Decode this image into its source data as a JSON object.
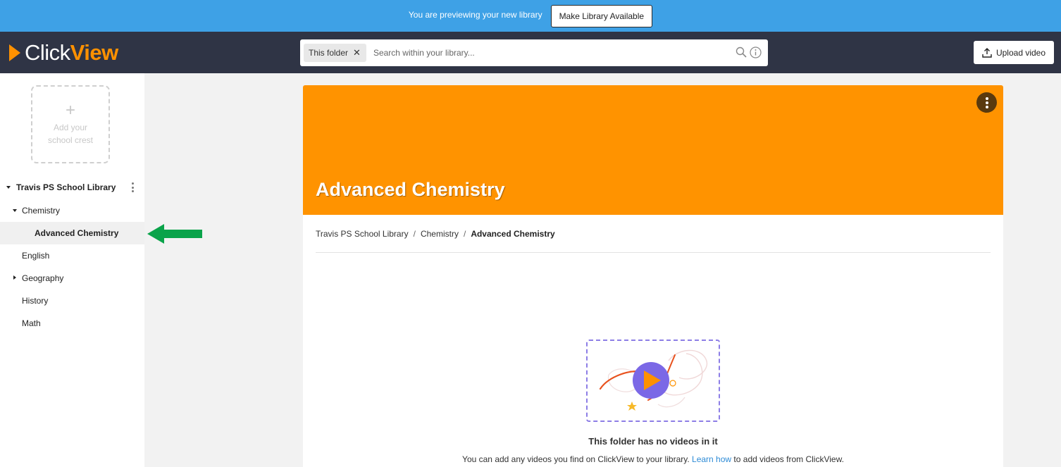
{
  "preview_bar": {
    "message": "You are previewing your new library",
    "make_available_label": "Make Library Available"
  },
  "header": {
    "logo_click": "Click",
    "logo_view": "View",
    "search": {
      "chip_label": "This folder",
      "placeholder": "Search within your library..."
    },
    "upload_label": "Upload video"
  },
  "sidebar": {
    "crest_plus": "+",
    "crest_label": "Add your school crest",
    "tree": {
      "root": "Travis PS School Library",
      "items": [
        {
          "label": "Chemistry",
          "caret": "down"
        },
        {
          "label": "Advanced Chemistry",
          "selected": true
        },
        {
          "label": "English"
        },
        {
          "label": "Geography",
          "caret": "right"
        },
        {
          "label": "History"
        },
        {
          "label": "Math"
        }
      ]
    }
  },
  "folder": {
    "title": "Advanced Chemistry",
    "banner_color": "#ff9300",
    "breadcrumb": [
      "Travis PS School Library",
      "Chemistry",
      "Advanced Chemistry"
    ],
    "breadcrumb_separator": "/"
  },
  "empty_state": {
    "title": "This folder has no videos in it",
    "desc_before": "You can add any videos you find on ClickView to your library.",
    "link": "Learn how",
    "desc_after": "to add videos from ClickView."
  },
  "colors": {
    "preview_bar": "#3ea1e6",
    "header": "#2f3445",
    "brand_orange": "#ff9100",
    "arrow_green": "#0aa34a"
  }
}
